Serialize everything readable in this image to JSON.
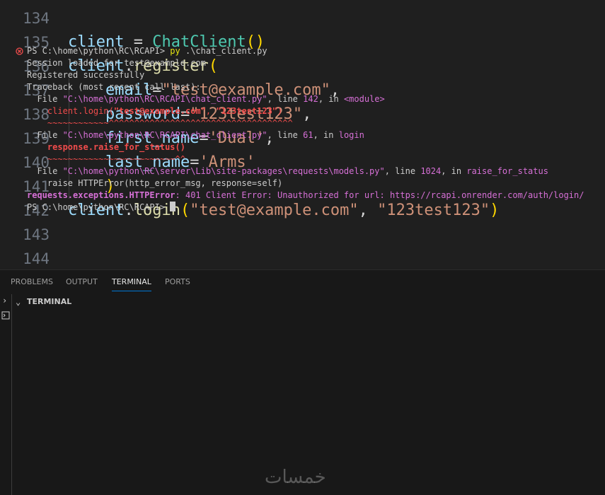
{
  "editor": {
    "lines": [
      {
        "num": "134",
        "tokens": []
      },
      {
        "num": "135",
        "tokens": [
          {
            "t": "client",
            "c": "t-var"
          },
          {
            "t": " = ",
            "c": "t-op"
          },
          {
            "t": "ChatClient",
            "c": "t-cls"
          },
          {
            "t": "()",
            "c": "t-br1"
          }
        ]
      },
      {
        "num": "136",
        "tokens": [
          {
            "t": "client",
            "c": "t-var"
          },
          {
            "t": ".",
            "c": "t-op"
          },
          {
            "t": "register",
            "c": "t-fn"
          },
          {
            "t": "(",
            "c": "t-br1"
          }
        ]
      },
      {
        "num": "137",
        "tokens": [
          {
            "t": "    email",
            "c": "t-var"
          },
          {
            "t": "=",
            "c": "t-op"
          },
          {
            "t": "\"test@example.com\"",
            "c": "t-str"
          },
          {
            "t": ",",
            "c": "t-punc"
          }
        ]
      },
      {
        "num": "138",
        "tokens": [
          {
            "t": "    password",
            "c": "t-var"
          },
          {
            "t": "=",
            "c": "t-op"
          },
          {
            "t": "\"123test123\"",
            "c": "t-str"
          },
          {
            "t": ",",
            "c": "t-punc"
          }
        ]
      },
      {
        "num": "139",
        "tokens": [
          {
            "t": "    first_name",
            "c": "t-var"
          },
          {
            "t": "=",
            "c": "t-op"
          },
          {
            "t": "'Dual'",
            "c": "t-str"
          },
          {
            "t": ",",
            "c": "t-punc"
          }
        ]
      },
      {
        "num": "140",
        "tokens": [
          {
            "t": "    last_name",
            "c": "t-var"
          },
          {
            "t": "=",
            "c": "t-op"
          },
          {
            "t": "'Arms'",
            "c": "t-str"
          }
        ]
      },
      {
        "num": "141",
        "tokens": [
          {
            "t": "    ",
            "c": "t-op"
          },
          {
            "t": ")",
            "c": "t-br1"
          }
        ]
      },
      {
        "num": "142",
        "tokens": [
          {
            "t": "client",
            "c": "t-var"
          },
          {
            "t": ".",
            "c": "t-op"
          },
          {
            "t": "login",
            "c": "t-fn"
          },
          {
            "t": "(",
            "c": "t-br1"
          },
          {
            "t": "\"test@example.com\"",
            "c": "t-str"
          },
          {
            "t": ", ",
            "c": "t-punc"
          },
          {
            "t": "\"123test123\"",
            "c": "t-str"
          },
          {
            "t": ")",
            "c": "t-br1"
          }
        ]
      },
      {
        "num": "143",
        "tokens": []
      },
      {
        "num": "144",
        "tokens": []
      }
    ]
  },
  "panel": {
    "tabs": [
      {
        "label": "PROBLEMS",
        "active": false
      },
      {
        "label": "OUTPUT",
        "active": false
      },
      {
        "label": "TERMINAL",
        "active": true
      },
      {
        "label": "PORTS",
        "active": false
      }
    ],
    "section_title": "TERMINAL"
  },
  "terminal": {
    "lines": [
      [
        {
          "t": "PS C:\\home\\python\\RC\\RCAPI> ",
          "c": "c-def"
        },
        {
          "t": "py",
          "c": "c-yel"
        },
        {
          "t": " .\\chat_client.py",
          "c": "c-def"
        }
      ],
      [
        {
          "t": "Session loaded for test@example.com",
          "c": "c-def"
        }
      ],
      [
        {
          "t": "Registered successfully",
          "c": "c-def"
        }
      ],
      [
        {
          "t": "Traceback (most recent call last):",
          "c": "c-def"
        }
      ],
      [
        {
          "t": "  File ",
          "c": "c-def"
        },
        {
          "t": "\"C:\\home\\python\\RC\\RCAPI\\chat_client.py\"",
          "c": "c-path"
        },
        {
          "t": ", line ",
          "c": "c-def"
        },
        {
          "t": "142",
          "c": "c-path"
        },
        {
          "t": ", in ",
          "c": "c-def"
        },
        {
          "t": "<module>",
          "c": "c-path"
        }
      ],
      [
        {
          "t": "    client.login(",
          "c": "c-red"
        },
        {
          "t": "\"test@example.com\"",
          "c": "c-redb"
        },
        {
          "t": ", ",
          "c": "c-red"
        },
        {
          "t": "\"123test123\"",
          "c": "c-redb"
        },
        {
          "t": ")",
          "c": "c-red"
        }
      ],
      [
        {
          "t": "    ~~~~~~~~~~~~^^^^^^^^^^^^^^^^^^^^^^^^^^^^^^^^^^^^",
          "c": "c-red"
        }
      ],
      [
        {
          "t": "  File ",
          "c": "c-def"
        },
        {
          "t": "\"C:\\home\\python\\RC\\RCAPI\\chat_client.py\"",
          "c": "c-path"
        },
        {
          "t": ", line ",
          "c": "c-def"
        },
        {
          "t": "61",
          "c": "c-path"
        },
        {
          "t": ", in ",
          "c": "c-def"
        },
        {
          "t": "login",
          "c": "c-path"
        }
      ],
      [
        {
          "t": "    response.raise_for_status()",
          "c": "c-redb"
        }
      ],
      [
        {
          "t": "    ~~~~~~~~~~~~~~~~~~~~~~~~~^^",
          "c": "c-red"
        }
      ],
      [
        {
          "t": "  File ",
          "c": "c-def"
        },
        {
          "t": "\"C:\\home\\python\\RC\\server\\Lib\\site-packages\\requests\\models.py\"",
          "c": "c-path"
        },
        {
          "t": ", line ",
          "c": "c-def"
        },
        {
          "t": "1024",
          "c": "c-path"
        },
        {
          "t": ", in ",
          "c": "c-def"
        },
        {
          "t": "raise_for_status",
          "c": "c-path"
        }
      ],
      [
        {
          "t": "    raise HTTPError(http_error_msg, response=self)",
          "c": "c-def"
        }
      ],
      [
        {
          "t": "requests.exceptions.HTTPError",
          "c": "c-magb"
        },
        {
          "t": ": 401 Client Error: Unauthorized for url: https://rcapi.onrender.com/auth/login/",
          "c": "c-mag"
        }
      ],
      [
        {
          "t": "PS C:\\home\\python\\RC\\RCAPI> ",
          "c": "c-def"
        }
      ]
    ]
  },
  "watermark": "خمسات"
}
